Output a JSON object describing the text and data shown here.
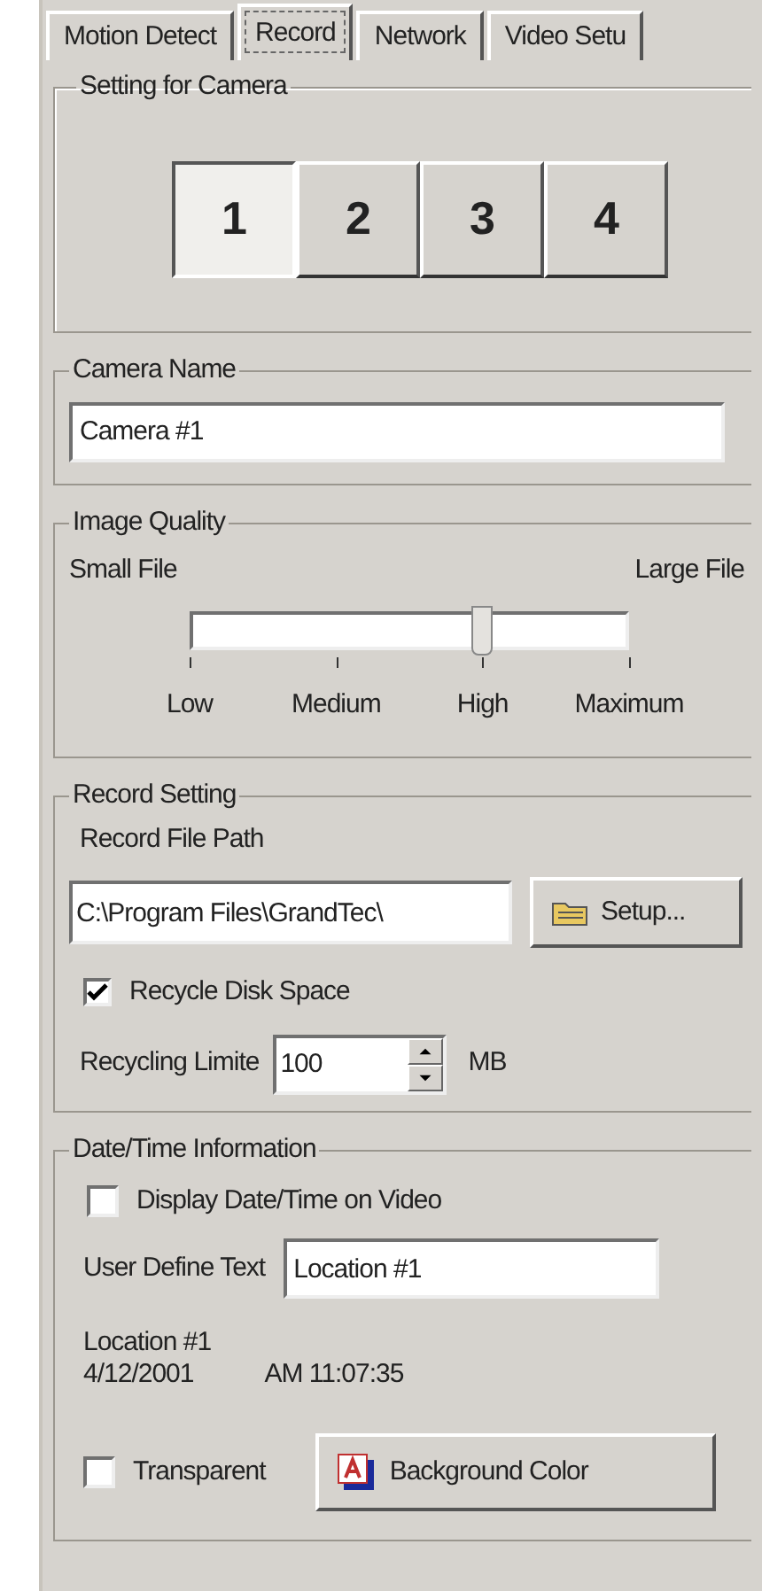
{
  "tabs": [
    {
      "label": "Motion Detect",
      "selected": false
    },
    {
      "label": "Record",
      "selected": true
    },
    {
      "label": "Network",
      "selected": false
    },
    {
      "label": "Video Setu",
      "selected": false
    }
  ],
  "camera_setting": {
    "title": "Setting for Camera",
    "cameras": [
      {
        "label": "1",
        "selected": true
      },
      {
        "label": "2",
        "selected": false
      },
      {
        "label": "3",
        "selected": false
      },
      {
        "label": "4",
        "selected": false
      }
    ]
  },
  "camera_name": {
    "title": "Camera Name",
    "value": "Camera #1"
  },
  "image_quality": {
    "title": "Image Quality",
    "min_label": "Small File",
    "max_label": "Large File",
    "level": 0.667,
    "ticks": [
      "Low",
      "Medium",
      "High",
      "Maximum"
    ]
  },
  "record_setting": {
    "title": "Record Setting",
    "path_label": "Record File Path",
    "path_value": "C:\\Program Files\\GrandTec\\",
    "setup_button": "Setup...",
    "recycle": {
      "label": "Recycle Disk Space",
      "checked": true
    },
    "limit": {
      "label": "Recycling Limite",
      "value": "100",
      "unit": "MB"
    }
  },
  "date_time": {
    "title": "Date/Time Information",
    "display": {
      "label": "Display Date/Time on Video",
      "checked": false
    },
    "user_text": {
      "label": "User Define Text",
      "value": "Location #1"
    },
    "preview_text": "Location #1",
    "preview_date": "4/12/2001",
    "preview_time": "AM 11:07:35",
    "transparent": {
      "label": "Transparent",
      "checked": false
    },
    "color_button": "Background Color"
  }
}
